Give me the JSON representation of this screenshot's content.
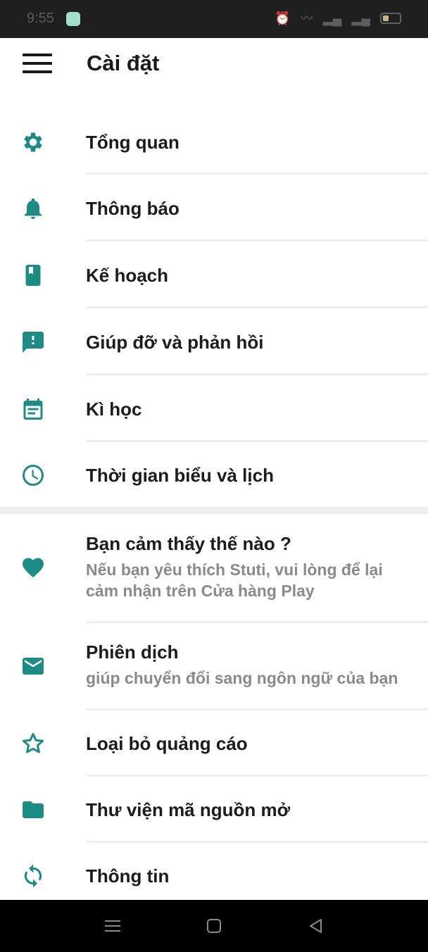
{
  "status_bar": {
    "time": "9:55"
  },
  "app_bar": {
    "title": "Cài đặt"
  },
  "colors": {
    "accent": "#1c8c85",
    "subtext": "#8a8a8a"
  },
  "section1": [
    {
      "icon": "gear-icon",
      "title": "Tổng quan"
    },
    {
      "icon": "bell-icon",
      "title": "Thông báo"
    },
    {
      "icon": "bookmark-book-icon",
      "title": "Kế hoạch"
    },
    {
      "icon": "feedback-icon",
      "title": "Giúp đỡ và phản hồi"
    },
    {
      "icon": "calendar-icon",
      "title": "Kì học"
    },
    {
      "icon": "clock-icon",
      "title": "Thời gian biểu và lịch"
    }
  ],
  "section2": [
    {
      "icon": "heart-icon",
      "title": "Bạn cảm thấy thế nào ?",
      "subtitle": "Nếu bạn yêu thích Stuti, vui lòng để lại cảm nhận trên Cửa hàng Play"
    },
    {
      "icon": "mail-icon",
      "title": "Phiên dịch",
      "subtitle": "giúp chuyển đổi sang ngôn ngữ của bạn"
    },
    {
      "icon": "star-outline-icon",
      "title": "Loại bỏ quảng cáo"
    },
    {
      "icon": "folder-icon",
      "title": "Thư viện mã nguồn mở"
    },
    {
      "icon": "sync-icon",
      "title": "Thông tin"
    }
  ]
}
